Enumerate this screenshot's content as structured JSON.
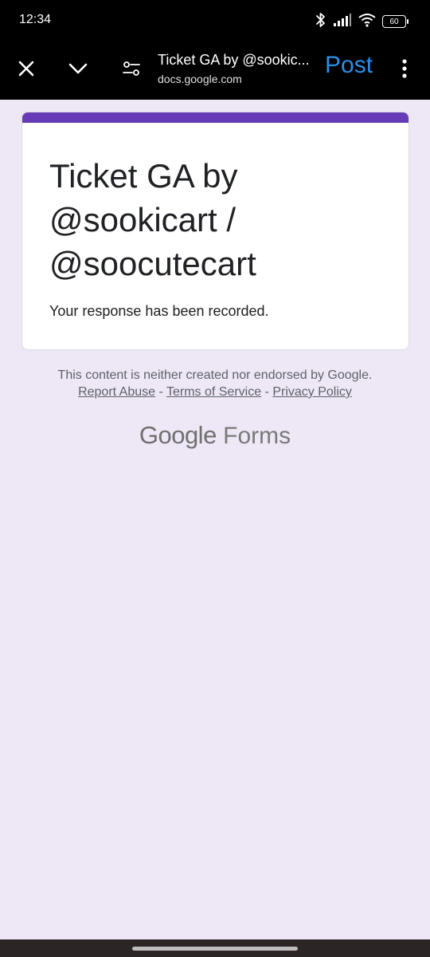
{
  "status_bar": {
    "time": "12:34",
    "battery": "60",
    "icons": [
      "bluetooth-icon",
      "signal-icon",
      "wifi-icon",
      "battery-icon"
    ]
  },
  "toolbar": {
    "page_title": "Ticket GA by @sookic...",
    "page_url": "docs.google.com",
    "post_label": "Post",
    "icons": [
      "close-icon",
      "chevron-down-icon",
      "page-settings-icon",
      "more-vert-icon"
    ],
    "post_color": "#2b8ee8"
  },
  "form": {
    "title": "Ticket GA by @sookicart / @soocutecart",
    "message": "Your response has been recorded.",
    "accent_color": "#673ab7"
  },
  "footer": {
    "disclaimer": "This content is neither created nor endorsed by Google.",
    "report_abuse": "Report Abuse",
    "terms": "Terms of Service",
    "privacy": "Privacy Policy",
    "separator": " - "
  },
  "brand": {
    "google": "Google",
    "forms": "Forms"
  }
}
